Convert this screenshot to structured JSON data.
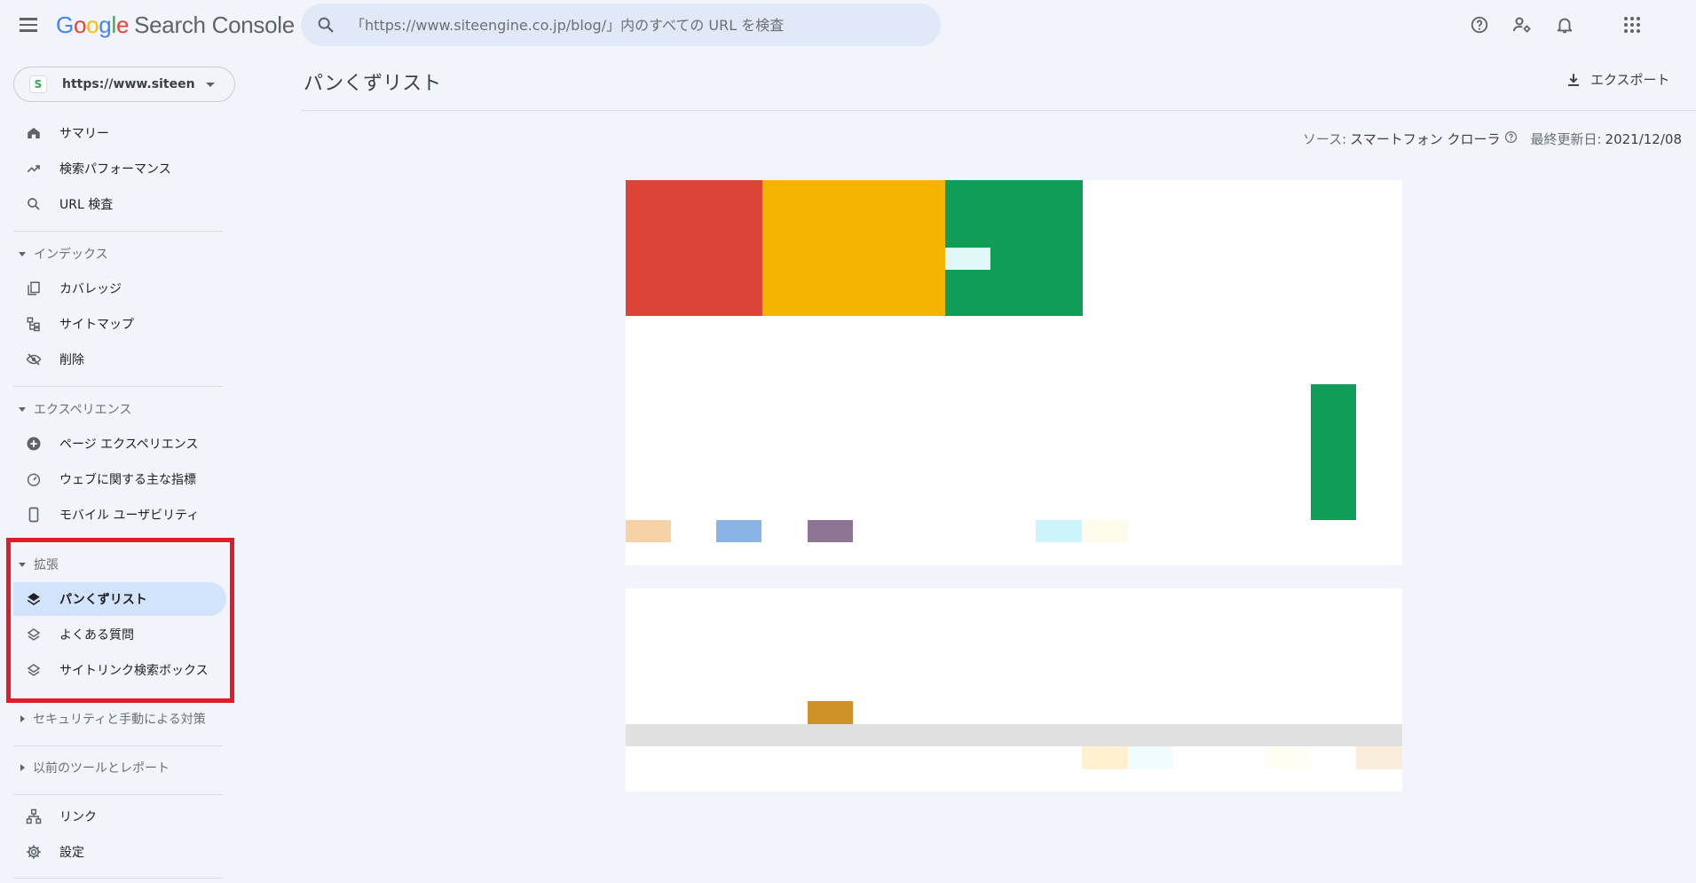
{
  "app": {
    "logo_letters": [
      "G",
      "o",
      "o",
      "g",
      "l",
      "e"
    ],
    "product": "Search Console"
  },
  "search": {
    "placeholder": "「https://www.siteengine.co.jp/blog/」内のすべての URL を検査"
  },
  "property": {
    "label": "https://www.siteeng...",
    "favicon_letter": "S"
  },
  "icons": {
    "menu": "hamburger-menu-icon",
    "search": "search-icon",
    "help": "help-circle-icon",
    "account_settings": "manage-accounts-icon",
    "notifications": "bell-icon",
    "apps": "apps-grid-icon",
    "export": "download-icon"
  },
  "sidebar": {
    "top_items": [
      {
        "label": "サマリー",
        "icon": "home-icon"
      },
      {
        "label": "検索パフォーマンス",
        "icon": "trending-up-icon"
      },
      {
        "label": "URL 検査",
        "icon": "search-icon"
      }
    ],
    "index_section": {
      "label": "インデックス",
      "items": [
        {
          "label": "カバレッジ",
          "icon": "copy-pages-icon"
        },
        {
          "label": "サイトマップ",
          "icon": "sitemap-icon"
        },
        {
          "label": "削除",
          "icon": "eye-off-icon"
        }
      ]
    },
    "experience_section": {
      "label": "エクスペリエンス",
      "items": [
        {
          "label": "ページ エクスペリエンス",
          "icon": "add-circle-icon"
        },
        {
          "label": "ウェブに関する主な指標",
          "icon": "speed-gauge-icon"
        },
        {
          "label": "モバイル ユーザビリティ",
          "icon": "smartphone-icon"
        }
      ]
    },
    "enhancements_section": {
      "label": "拡張",
      "items": [
        {
          "label": "パンくずリスト",
          "icon": "layers-icon",
          "active": true
        },
        {
          "label": "よくある質問",
          "icon": "layers-icon"
        },
        {
          "label": "サイトリンク検索ボックス",
          "icon": "layers-icon"
        }
      ]
    },
    "security_section": {
      "label": "セキュリティと手動による対策"
    },
    "legacy_section": {
      "label": "以前のツールとレポート"
    },
    "bottom_items": [
      {
        "label": "リンク",
        "icon": "links-tree-icon"
      },
      {
        "label": "設定",
        "icon": "gear-icon"
      }
    ]
  },
  "main": {
    "title": "パンくずリスト",
    "export_label": "エクスポート",
    "source_key": "ソース:",
    "source_value": "スマートフォン クローラ",
    "updated_key": "最終更新日:",
    "updated_value": "2021/12/08"
  },
  "colors": {
    "accent": "#1a73e8",
    "active_bg": "#d2e3fc",
    "highlight_box": "#e21b28",
    "red": "#db4437",
    "yellow": "#f4b400",
    "green": "#0f9d58"
  }
}
